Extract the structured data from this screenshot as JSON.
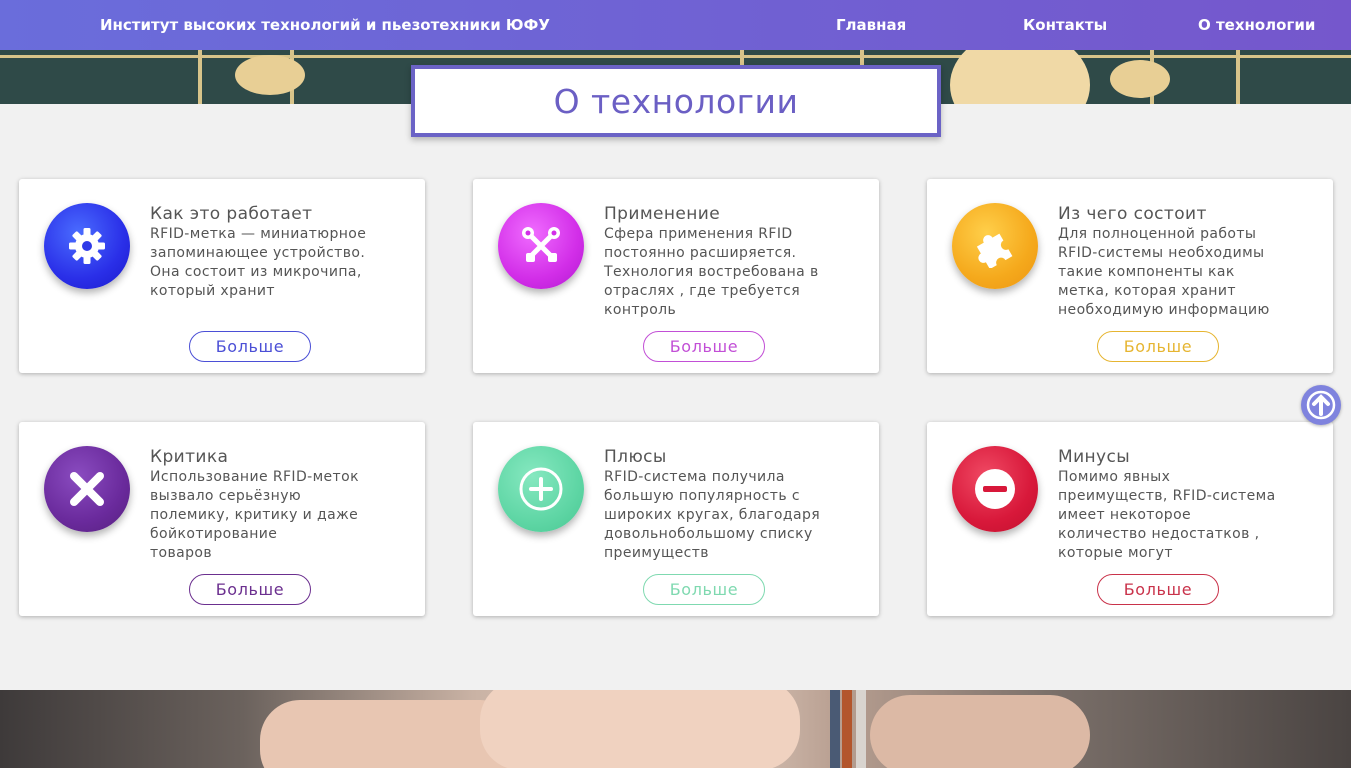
{
  "navbar": {
    "brand": "Институт высоких технологий и пьезотехники ЮФУ",
    "links": [
      "Главная",
      "Контакты",
      "О технологии"
    ]
  },
  "title": "О технологии",
  "cards": [
    {
      "title": "Как это работает",
      "text": "RFID-метка — миниатюрное\nзапоминающее устройство.\nОна состоит из микрочипа,\nкоторый хранит",
      "button": "Больше",
      "icon": "gear-icon",
      "color": "#4b4fd6"
    },
    {
      "title": "Применение",
      "text": "Сфера применения RFID\nпостоянно расширяется.\nТехнология востребована в\nотраслях , где требуется\nконтроль",
      "button": "Больше",
      "icon": "tools-icon",
      "color": "#c24fd6"
    },
    {
      "title": "Из чего состоит",
      "text": "Для полноценной работы\nRFID-системы необходимы\nтакие компоненты как\nметка, которая хранит\nнеобходимую информацию",
      "button": "Больше",
      "icon": "puzzle-icon",
      "color": "#e6b531"
    },
    {
      "title": "Критика",
      "text": "Использование RFID-меток\nвызвало серьёзную\nполемику, критику и даже\nбойкотирование\nтоваров",
      "button": "Больше",
      "icon": "close-icon",
      "color": "#6b2f8f"
    },
    {
      "title": "Плюсы",
      "text": "RFID-система получила\nбольшую популярность с\nшироких кругах, благодаря\nдовольнобольшому списку\nпреимуществ",
      "button": "Больше",
      "icon": "plus-icon",
      "color": "#7fd9b0"
    },
    {
      "title": "Минусы",
      "text": "Помимо явных\nпреимуществ, RFID-система\nимеет некоторое\nколичество недостатков ,\nкоторые могут",
      "button": "Больше",
      "icon": "minus-icon",
      "color": "#c9324a"
    }
  ],
  "scroll_top_icon": "arrow-up-icon"
}
